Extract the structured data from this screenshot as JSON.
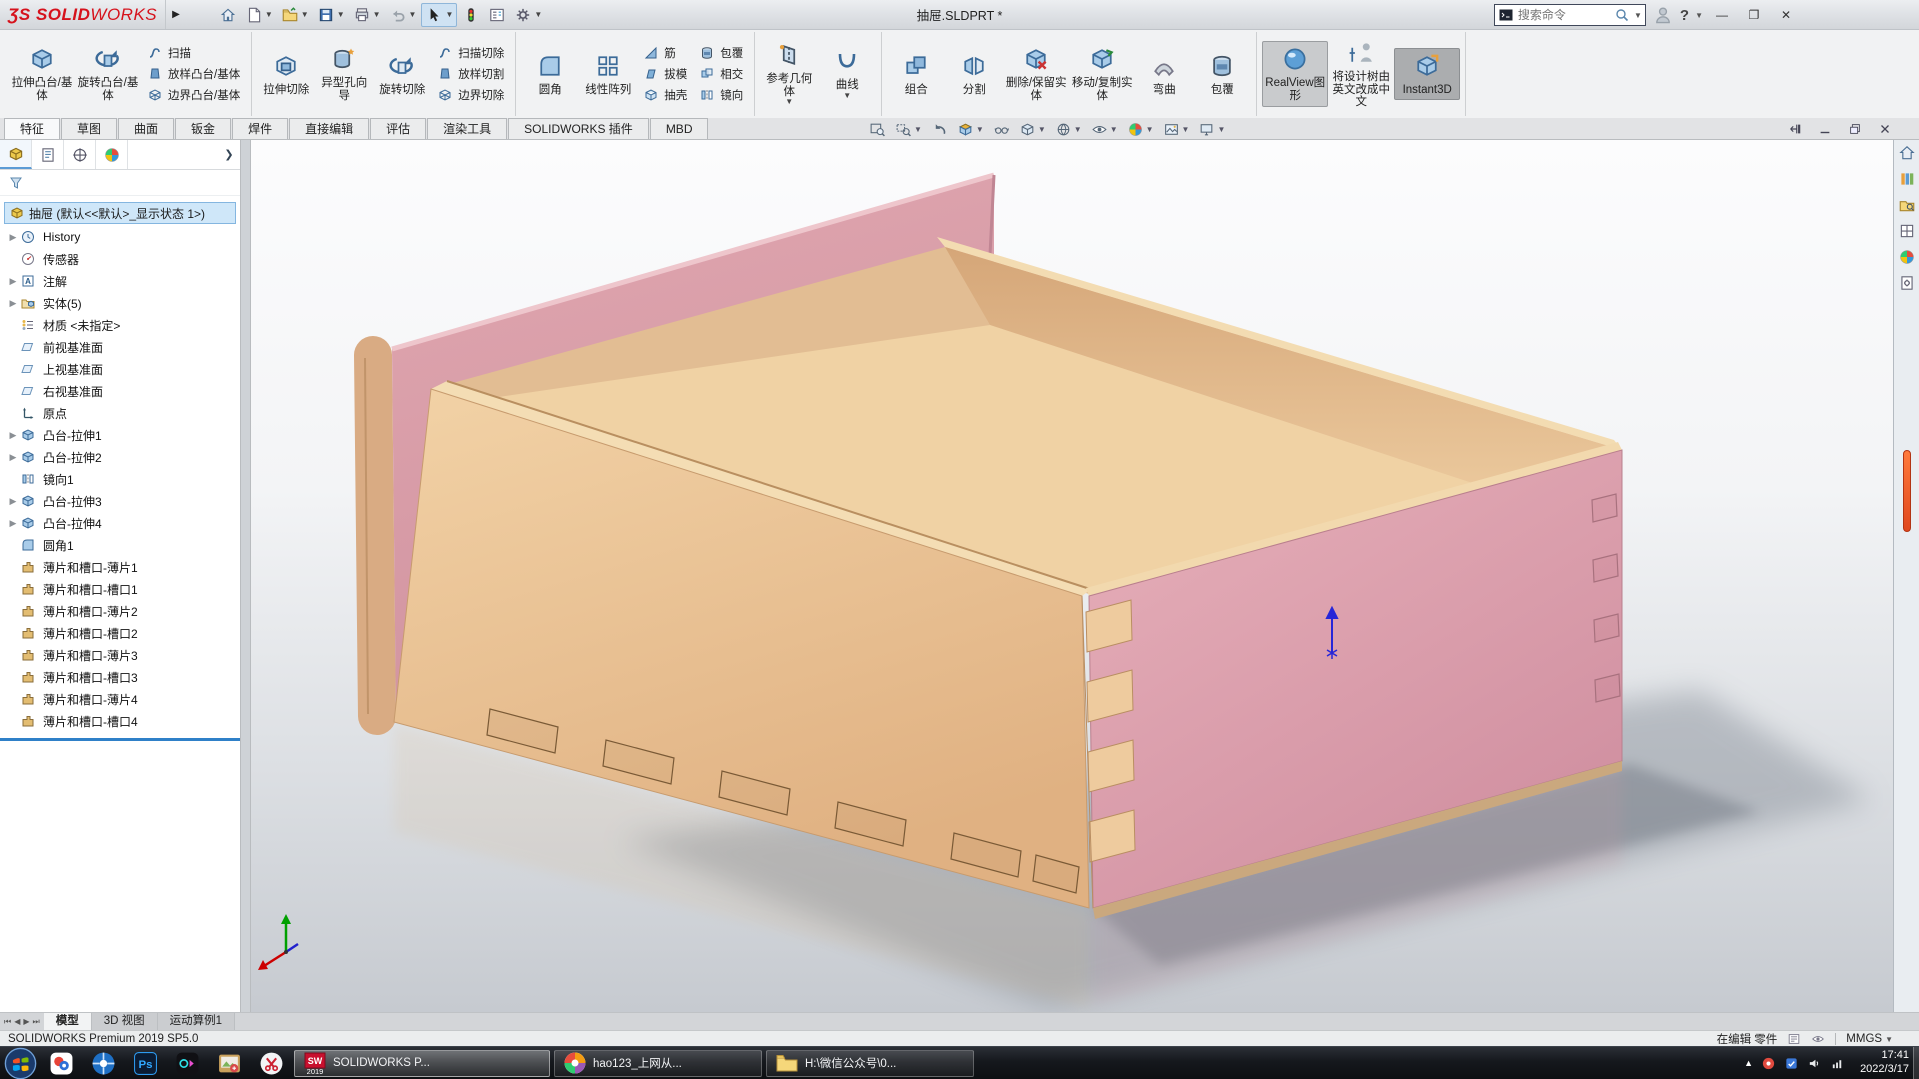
{
  "window": {
    "title": "抽屉.SLDPRT *",
    "search_placeholder": "搜索命令",
    "brand": "SOLIDWORKS",
    "brand_color": "#d6121c"
  },
  "quick_access": [
    {
      "icon": "home-icon"
    },
    {
      "icon": "new-icon",
      "dd": true
    },
    {
      "icon": "open-icon",
      "dd": true
    },
    {
      "icon": "save-icon",
      "dd": true
    },
    {
      "icon": "print-icon",
      "dd": true
    },
    {
      "icon": "undo-icon",
      "dd": true
    },
    {
      "icon": "select-icon",
      "dd": true,
      "pressed": true
    },
    {
      "icon": "stoplight-icon"
    },
    {
      "icon": "display-pane-icon"
    },
    {
      "icon": "options-icon",
      "dd": true
    }
  ],
  "ribbon": {
    "groups": [
      {
        "big": [
          {
            "label": "拉伸凸台/基体",
            "icon": "extrude-boss"
          },
          {
            "label": "旋转凸台/基体",
            "icon": "revolve-boss"
          }
        ],
        "stacks": [
          [
            {
              "label": "扫描",
              "icon": "sweep"
            },
            {
              "label": "放样凸台/基体",
              "icon": "loft"
            },
            {
              "label": "边界凸台/基体",
              "icon": "boundary"
            }
          ]
        ]
      },
      {
        "big": [
          {
            "label": "拉伸切除",
            "icon": "extrude-cut"
          },
          {
            "label": "异型孔向导",
            "icon": "hole-wizard"
          },
          {
            "label": "旋转切除",
            "icon": "revolve-cut"
          }
        ],
        "stacks": [
          [
            {
              "label": "扫描切除",
              "icon": "sweep"
            },
            {
              "label": "放样切割",
              "icon": "loft"
            },
            {
              "label": "边界切除",
              "icon": "boundary"
            }
          ]
        ]
      },
      {
        "big": [
          {
            "label": "圆角",
            "icon": "fillet"
          },
          {
            "label": "线性阵列",
            "icon": "pattern"
          }
        ],
        "stacks": [
          [
            {
              "label": "筋",
              "icon": "rib"
            },
            {
              "label": "拔模",
              "icon": "draft"
            },
            {
              "label": "抽壳",
              "icon": "shell"
            }
          ],
          [
            {
              "label": "包覆",
              "icon": "wrap"
            },
            {
              "label": "相交",
              "icon": "intersect"
            },
            {
              "label": "镜向",
              "icon": "mirror"
            }
          ]
        ]
      },
      {
        "big": [
          {
            "label": "参考几何体",
            "icon": "ref-geometry",
            "dd": true
          },
          {
            "label": "曲线",
            "icon": "curves",
            "dd": true
          }
        ],
        "stacks": []
      },
      {
        "big": [
          {
            "label": "组合",
            "icon": "combine"
          },
          {
            "label": "分割",
            "icon": "split"
          },
          {
            "label": "删除/保留实体",
            "icon": "delete-body"
          },
          {
            "label": "移动/复制实体",
            "icon": "move-body"
          },
          {
            "label": "弯曲",
            "icon": "flex"
          },
          {
            "label": "包覆",
            "icon": "wrap"
          }
        ],
        "stacks": []
      },
      {
        "big": [
          {
            "label": "RealView图形",
            "icon": "realview",
            "pressed": true
          },
          {
            "label": "将设计树由英文改成中文",
            "icon": "tree-lang"
          },
          {
            "label": "Instant3D",
            "icon": "instant3d",
            "pressed": true,
            "dark": true
          }
        ],
        "stacks": []
      }
    ],
    "tabs": [
      {
        "label": "特征",
        "active": true
      },
      {
        "label": "草图"
      },
      {
        "label": "曲面"
      },
      {
        "label": "钣金"
      },
      {
        "label": "焊件"
      },
      {
        "label": "直接编辑"
      },
      {
        "label": "评估"
      },
      {
        "label": "渲染工具"
      },
      {
        "label": "SOLIDWORKS 插件"
      },
      {
        "label": "MBD"
      }
    ]
  },
  "headsup": [
    {
      "icon": "zoom-fit-icon"
    },
    {
      "icon": "zoom-area-icon",
      "dd": true
    },
    {
      "icon": "previous-view-icon"
    },
    {
      "icon": "section-view-icon",
      "dd": true
    },
    {
      "icon": "annotation-view-icon"
    },
    {
      "icon": "view-orientation-icon",
      "dd": true
    },
    {
      "icon": "display-style-icon",
      "dd": true
    },
    {
      "icon": "hide-show-icon",
      "dd": true
    },
    {
      "icon": "edit-appearance-icon",
      "dd": true
    },
    {
      "icon": "apply-scene-icon",
      "dd": true
    },
    {
      "icon": "view-settings-icon",
      "dd": true
    }
  ],
  "doc_controls": [
    {
      "icon": "pin-panel-icon"
    },
    {
      "icon": "minimize-doc-icon"
    },
    {
      "icon": "restore-doc-icon"
    },
    {
      "icon": "close-doc-icon"
    }
  ],
  "feature_tree": {
    "root": "抽屉 (默认<<默认>_显示状态 1>)",
    "items": [
      {
        "label": "History",
        "icon": "history",
        "arrow": true
      },
      {
        "label": "传感器",
        "icon": "sensors",
        "arrow": false
      },
      {
        "label": "注解",
        "icon": "annotations",
        "arrow": true
      },
      {
        "label": "实体(5)",
        "icon": "solid-bodies",
        "arrow": true
      },
      {
        "label": "材质 <未指定>",
        "icon": "material",
        "arrow": false
      },
      {
        "label": "前视基准面",
        "icon": "plane",
        "arrow": false
      },
      {
        "label": "上视基准面",
        "icon": "plane",
        "arrow": false
      },
      {
        "label": "右视基准面",
        "icon": "plane",
        "arrow": false
      },
      {
        "label": "原点",
        "icon": "origin",
        "arrow": false
      },
      {
        "label": "凸台-拉伸1",
        "icon": "boss-extrude",
        "arrow": true
      },
      {
        "label": "凸台-拉伸2",
        "icon": "boss-extrude",
        "arrow": true
      },
      {
        "label": "镜向1",
        "icon": "mirror",
        "arrow": false
      },
      {
        "label": "凸台-拉伸3",
        "icon": "boss-extrude",
        "arrow": true
      },
      {
        "label": "凸台-拉伸4",
        "icon": "boss-extrude",
        "arrow": true
      },
      {
        "label": "圆角1",
        "icon": "fillet",
        "arrow": false
      },
      {
        "label": "薄片和槽口-薄片1",
        "icon": "tab-slot",
        "arrow": false
      },
      {
        "label": "薄片和槽口-槽口1",
        "icon": "tab-slot",
        "arrow": false
      },
      {
        "label": "薄片和槽口-薄片2",
        "icon": "tab-slot",
        "arrow": false
      },
      {
        "label": "薄片和槽口-槽口2",
        "icon": "tab-slot",
        "arrow": false
      },
      {
        "label": "薄片和槽口-薄片3",
        "icon": "tab-slot",
        "arrow": false
      },
      {
        "label": "薄片和槽口-槽口3",
        "icon": "tab-slot",
        "arrow": false
      },
      {
        "label": "薄片和槽口-薄片4",
        "icon": "tab-slot",
        "arrow": false
      },
      {
        "label": "薄片和槽口-槽口4",
        "icon": "tab-slot",
        "arrow": false
      }
    ]
  },
  "task_pane_icons": [
    "resources-home-icon",
    "design-library-icon",
    "file-explorer-icon",
    "view-palette-icon",
    "appearances-ball-icon",
    "custom-properties-icon"
  ],
  "doc_tabs": [
    {
      "label": "模型",
      "active": true
    },
    {
      "label": "3D 视图"
    },
    {
      "label": "运动算例1"
    }
  ],
  "status": {
    "left": "SOLIDWORKS Premium 2019 SP5.0",
    "mode": "在编辑 零件",
    "units": "MMGS"
  },
  "taskbar": {
    "app_icons": [
      "browser-360-icon",
      "aperture-icon",
      "photoshop-icon",
      "okplayer-icon",
      "photos-icon",
      "screenshot-icon"
    ],
    "windows": [
      {
        "icon": "solidworks-icon",
        "label": "SOLIDWORKS P...",
        "active": true
      },
      {
        "icon": "hao123-icon",
        "label": "hao123_上网从..."
      },
      {
        "icon": "folder-icon",
        "label": "H:\\微信公众号\\0..."
      }
    ],
    "time": "17:41",
    "date": "2022/3/17"
  },
  "model_colors": {
    "wood": "#e9c195",
    "wood_light": "#f3d5a9",
    "wood_dark": "#d9a97a",
    "pink": "#e2abb5",
    "pink_dark": "#d393a1",
    "edge_tan": "#d9ab83"
  }
}
